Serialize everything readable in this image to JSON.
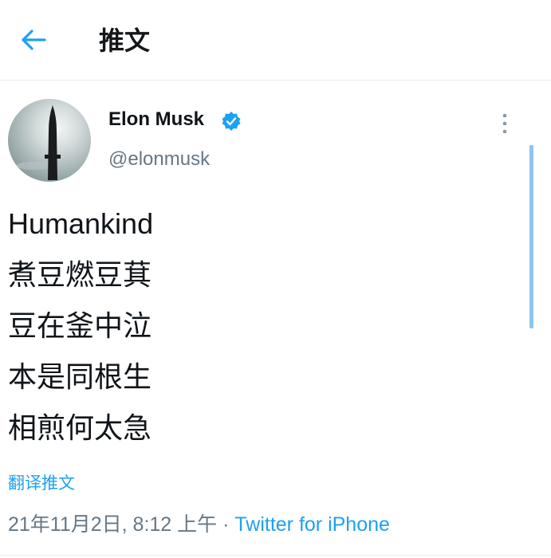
{
  "header": {
    "title": "推文"
  },
  "author": {
    "name": "Elon Musk",
    "handle": "@elonmusk"
  },
  "tweet": {
    "lines": [
      "Humankind",
      "煮豆燃豆萁",
      "豆在釜中泣",
      "本是同根生",
      "相煎何太急"
    ]
  },
  "translate_label": "翻译推文",
  "meta": {
    "timestamp": "21年11月2日, 8:12 上午",
    "separator": " · ",
    "source": "Twitter for iPhone"
  },
  "colors": {
    "accent": "#1da1f2",
    "secondary_text": "#657786"
  },
  "icons": {
    "back": "arrow-left-icon",
    "verified": "verified-badge-icon",
    "more": "more-vertical-icon"
  }
}
